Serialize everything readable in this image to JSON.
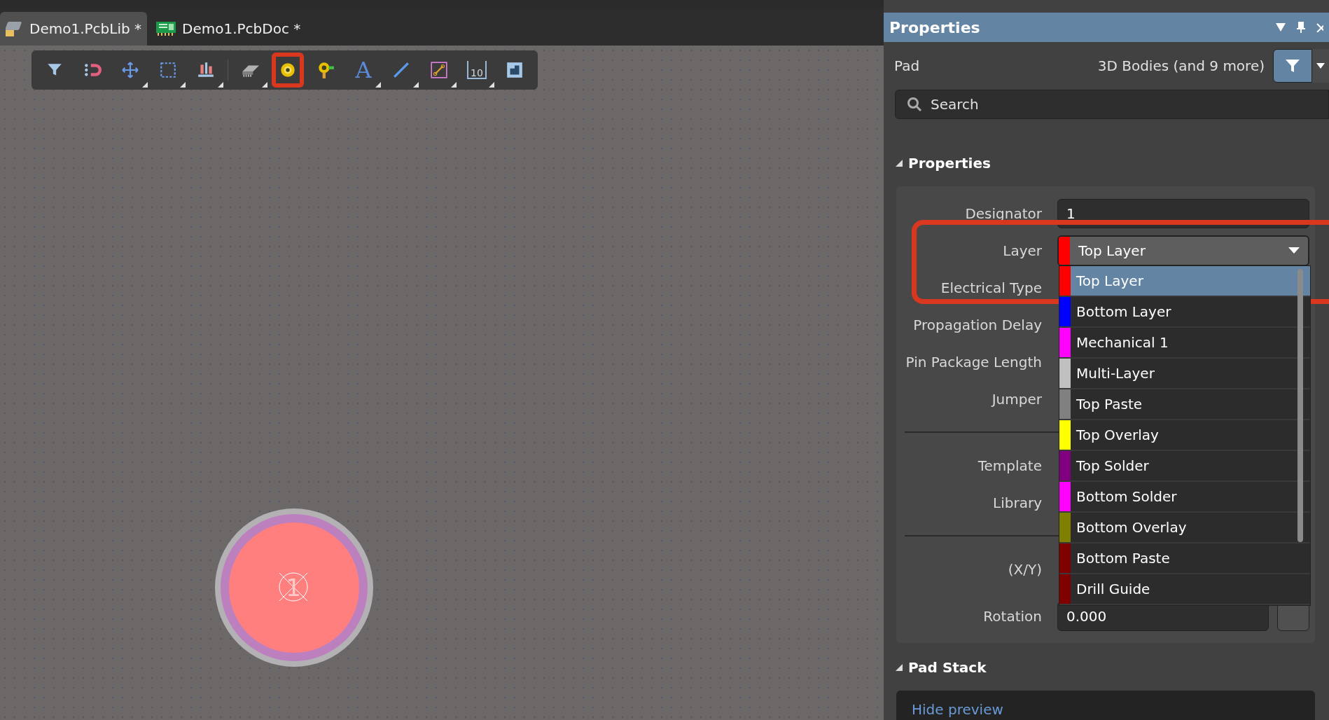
{
  "tabs": [
    {
      "label": "Demo1.PcbLib *",
      "kind": "pcblib",
      "selected": true
    },
    {
      "label": "Demo1.PcbDoc *",
      "kind": "pcbdoc",
      "selected": false
    }
  ],
  "toolbar": [
    {
      "kind": "filter",
      "has_menu": false,
      "highlighted": false
    },
    {
      "kind": "connect",
      "has_menu": false,
      "highlighted": false
    },
    {
      "kind": "move",
      "has_menu": true,
      "highlighted": false
    },
    {
      "kind": "select",
      "has_menu": true,
      "highlighted": false
    },
    {
      "kind": "align",
      "has_menu": true,
      "highlighted": false
    },
    {
      "kind": "component",
      "has_menu": true,
      "highlighted": false
    },
    {
      "kind": "pad",
      "has_menu": false,
      "highlighted": true
    },
    {
      "kind": "via",
      "has_menu": false,
      "highlighted": false
    },
    {
      "kind": "string",
      "glyph": "A",
      "has_menu": true,
      "highlighted": false
    },
    {
      "kind": "line",
      "has_menu": true,
      "highlighted": false
    },
    {
      "kind": "route",
      "has_menu": true,
      "highlighted": false
    },
    {
      "kind": "dimension",
      "glyph": "10",
      "has_menu": true,
      "highlighted": false
    },
    {
      "kind": "region",
      "has_menu": false,
      "highlighted": false
    }
  ],
  "canvas": {
    "pad": {
      "label": "1"
    }
  },
  "panel": {
    "title": "Properties",
    "object": "Pad",
    "filter_summary": "3D Bodies (and 9 more)",
    "search": {
      "placeholder": "Search"
    },
    "sections": [
      {
        "title": "Properties",
        "expanded": true,
        "fields": [
          {
            "kind": "text",
            "label": "Designator",
            "value": "1"
          },
          {
            "kind": "dropdown",
            "label": "Layer",
            "value": "Top Layer",
            "color": "#ff0000",
            "open": true,
            "callout": true
          },
          {
            "kind": "label",
            "label": "Electrical Type"
          },
          {
            "kind": "label",
            "label": "Propagation Delay"
          },
          {
            "kind": "label",
            "label": "Pin Package Length"
          },
          {
            "kind": "label",
            "label": "Jumper"
          },
          {
            "kind": "divider"
          },
          {
            "kind": "label",
            "label": "Template"
          },
          {
            "kind": "label",
            "label": "Library"
          },
          {
            "kind": "divider"
          },
          {
            "kind": "label",
            "label": "(X/Y)"
          },
          {
            "kind": "text_button",
            "label": "Rotation",
            "value": "0.000"
          }
        ]
      },
      {
        "title": "Pad Stack",
        "expanded": true,
        "link": "Hide preview"
      }
    ],
    "layer_options": [
      {
        "label": "Top Layer",
        "color": "#ff0000",
        "selected": true
      },
      {
        "label": "Bottom Layer",
        "color": "#0000ff",
        "selected": false
      },
      {
        "label": "Mechanical 1",
        "color": "#ff00ff",
        "selected": false
      },
      {
        "label": "Multi-Layer",
        "color": "#c0c0c0",
        "selected": false
      },
      {
        "label": "Top Paste",
        "color": "#808080",
        "selected": false
      },
      {
        "label": "Top Overlay",
        "color": "#ffff00",
        "selected": false
      },
      {
        "label": "Top Solder",
        "color": "#800080",
        "selected": false
      },
      {
        "label": "Bottom Solder",
        "color": "#ff00ff",
        "selected": false
      },
      {
        "label": "Bottom Overlay",
        "color": "#808000",
        "selected": false
      },
      {
        "label": "Bottom Paste",
        "color": "#800000",
        "selected": false
      },
      {
        "label": "Drill Guide",
        "color": "#800000",
        "selected": false
      }
    ]
  }
}
